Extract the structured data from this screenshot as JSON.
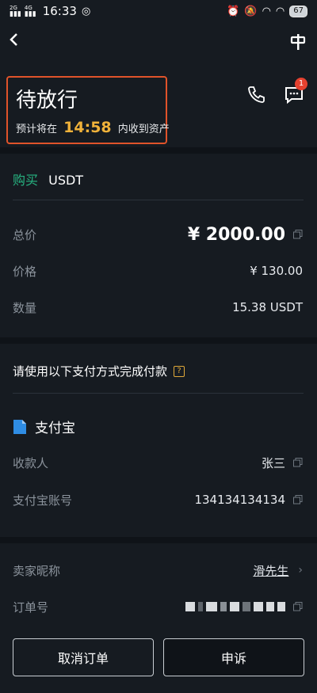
{
  "status_bar": {
    "signal_left": "2G",
    "signal_right": "4G",
    "time": "16:33",
    "battery": "67"
  },
  "header": {
    "status_title": "待放行",
    "sub_prefix": "预计将在",
    "countdown": "14:58",
    "sub_suffix": "内收到资产",
    "chat_badge": "1"
  },
  "trade": {
    "side": "购买",
    "coin": "USDT",
    "total_label": "总价",
    "total_value": "¥ 2000.00",
    "price_label": "价格",
    "price_value": "¥ 130.00",
    "qty_label": "数量",
    "qty_value": "15.38 USDT"
  },
  "payment": {
    "instruction": "请使用以下支付方式完成付款",
    "help_mark": "?",
    "method": "支付宝",
    "payee_label": "收款人",
    "payee_value": "张三",
    "account_label": "支付宝账号",
    "account_value": "134134134134"
  },
  "seller": {
    "nick_label": "卖家昵称",
    "nick_value": "滑先生",
    "order_label": "订单号"
  },
  "actions": {
    "cancel_label": "取消订单",
    "appeal_label": "申诉"
  },
  "colors": {
    "accent_buy": "#27b582",
    "countdown": "#f0b23a",
    "highlight_box": "#e0532a",
    "badge": "#e4412f"
  }
}
